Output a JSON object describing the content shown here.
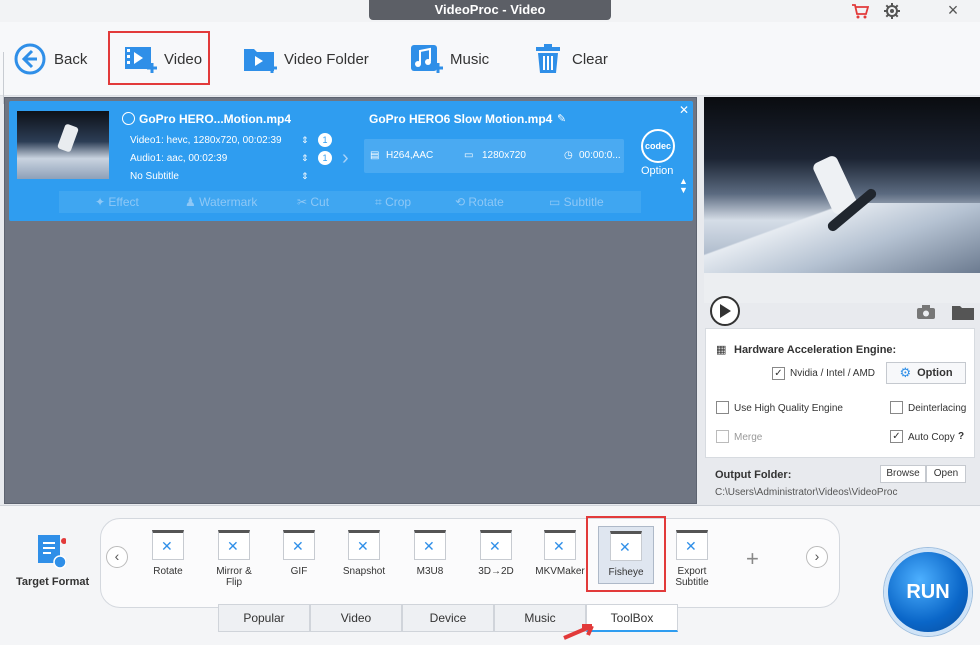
{
  "window": {
    "title": "VideoProc - Video"
  },
  "toolbar": {
    "back": "Back",
    "video": "Video",
    "video_folder": "Video Folder",
    "music": "Music",
    "clear": "Clear"
  },
  "card": {
    "source_name": "GoPro HERO...Motion.mp4",
    "video_track": "Video1: hevc, 1280x720, 00:02:39",
    "audio_track": "Audio1: aac, 00:02:39",
    "subtitle": "No Subtitle",
    "video_count": "1",
    "audio_count": "1",
    "output_name": "GoPro HERO6 Slow Motion.mp4",
    "codec_spec": "H264,AAC",
    "resolution": "1280x720",
    "duration": "00:00:0...",
    "codec_icon": "codec",
    "option": "Option",
    "edit_tools": [
      "Effect",
      "Watermark",
      "Cut",
      "Crop",
      "Rotate",
      "Subtitle"
    ]
  },
  "settings": {
    "hw_title": "Hardware Acceleration Engine:",
    "hw_vendor": "Nvidia / Intel / AMD",
    "option": "Option",
    "high_quality": "Use High Quality Engine",
    "deinterlacing": "Deinterlacing",
    "merge": "Merge",
    "auto_copy": "Auto Copy",
    "help": "?",
    "output_folder_label": "Output Folder:",
    "browse": "Browse",
    "open": "Open",
    "output_path": "C:\\Users\\Administrator\\Videos\\VideoProc"
  },
  "format_bar": {
    "target_format": "Target Format",
    "tools": [
      {
        "name": "Rotate"
      },
      {
        "name": "Mirror &\nFlip"
      },
      {
        "name": "GIF"
      },
      {
        "name": "Snapshot"
      },
      {
        "name": "M3U8"
      },
      {
        "name": "3D→2D"
      },
      {
        "name": "MKVMaker"
      },
      {
        "name": "Fisheye"
      },
      {
        "name": "Export\nSubtitle"
      }
    ],
    "selected": "Fisheye"
  },
  "tabs": [
    "Popular",
    "Video",
    "Device",
    "Music",
    "ToolBox"
  ],
  "active_tab": "ToolBox",
  "run": "RUN",
  "colors": {
    "accent": "#2f9df0",
    "highlight": "#e23a3a",
    "run": "#0a66c8"
  }
}
